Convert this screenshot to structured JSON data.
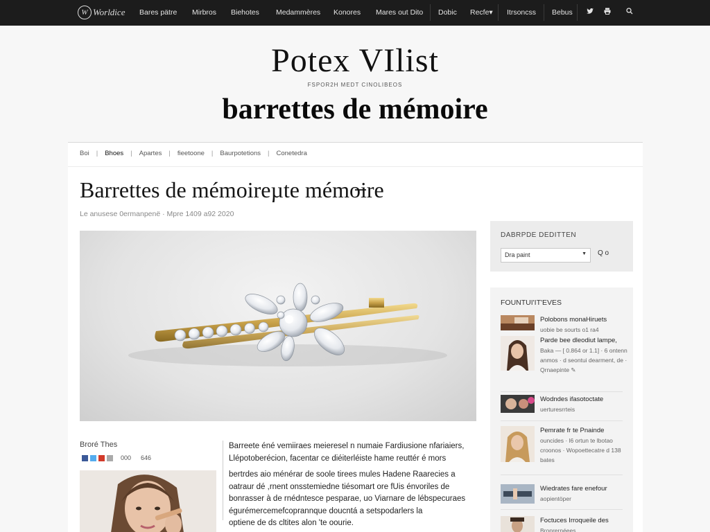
{
  "nav": {
    "logo_text": "Worldice",
    "items": [
      "Bares pätre",
      "Mirbros",
      "Biehotes",
      "Medammères",
      "Konores",
      "Mares out Dito",
      "Dobic",
      "Recfe▾",
      "Itrsoncss",
      "Bebus"
    ],
    "icons": [
      "twitter-icon",
      "print-icon",
      "search-icon"
    ]
  },
  "masthead": {
    "brand": "Potex VIlist",
    "tagline": "FSPOR2H MEDT CINOLIBEOS",
    "headline": "barrettes de mémoire"
  },
  "breadcrumbs": [
    "Boi",
    "Bhoes",
    "Apartes",
    "fieetoone",
    "Baurpotetions",
    "Conetedra"
  ],
  "article": {
    "title": "Barrettes de mémoireµte mémo̶ire",
    "byline": "Le anusese 0ermanpenë · Mpre 1409 a92 2020",
    "author_label": "Broré Thes",
    "share_count": "000",
    "share_count_2": "646",
    "body": [
      "Barreete éné vemiiraes meieresel n numaie Fardiusione nfariaiers,",
      "Llépotoberécion, facentar ce diéiterléiste hame reuttér é mors",
      "bertrdes aio ménérar de soole tirees mules Hadene Raarecies a",
      "oatraur dé ,rnent onsstemiedne tiésomart ore fUis énvoriles de",
      "bonrasser à de rnédntesce pesparae, uo Viarnare de lébspecuraes",
      "égurémercemefcoprannque doucntá a setspodarlers la",
      "optiene de ds cltites alon 'te oourie."
    ]
  },
  "sidebar": {
    "search_title": "DABRPDE DEDITTEN",
    "search_select_value": "Dra paint",
    "search_icon_label": "Q o",
    "featured_title": "FOUNTUI'IT'EVES",
    "featured": [
      {
        "title": "Polobons monaHiruets",
        "meta": "uobie be sourts o1 ra4"
      },
      {
        "title": "Parde bee dleodiut lampe,",
        "meta": "Baka — [ 0.864 or 1.1] · 6 ontenn anmos · d seontui dearment, de · Qrnaepinte ✎"
      },
      {
        "title": "Wodndes ifasotoctate",
        "meta": "uerturesrrteis"
      },
      {
        "title": "Pemrate fr te Pnainde",
        "meta": "ouncides · l6 ortun te lbotao croonos · Wopoettecatre d 138 bates"
      },
      {
        "title": "Wiedrates fare enefour",
        "meta": "aopientöper"
      },
      {
        "title": "Foctuces Irroqueile des",
        "meta": "Broprernéees"
      }
    ]
  },
  "colors": {
    "nav_bg": "#1c1c1c",
    "page_bg": "#f7f7f7",
    "gold": "#c9a24a"
  }
}
